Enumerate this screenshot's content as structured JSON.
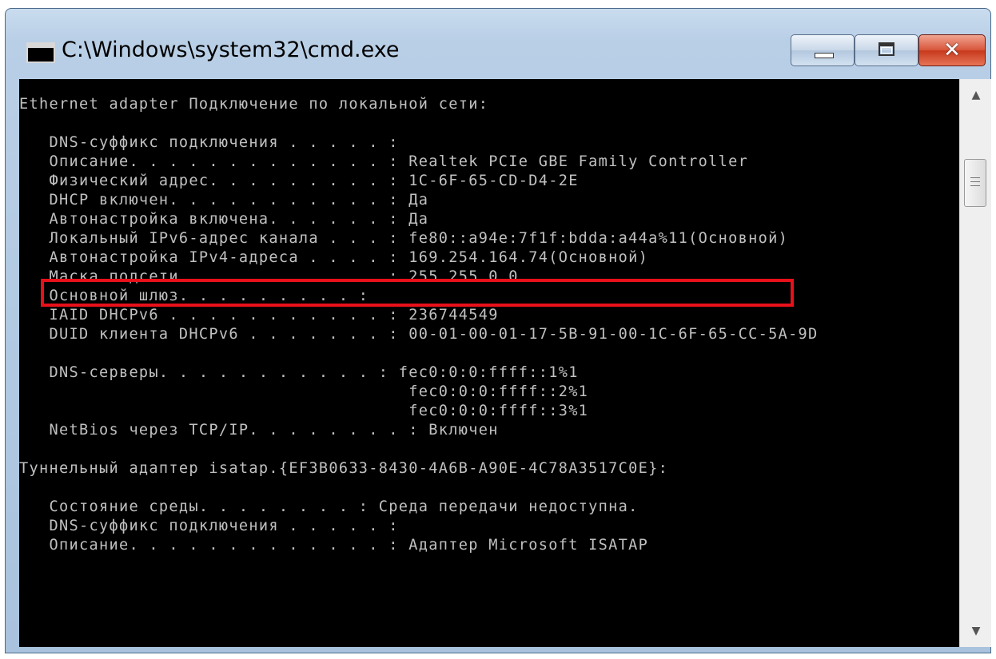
{
  "window": {
    "title": "C:\\Windows\\system32\\cmd.exe",
    "icon": "cmd-console-icon",
    "controls": {
      "minimize": "minimize-icon",
      "maximize": "maximize-icon",
      "close_glyph": "✕"
    },
    "colors": {
      "console_bg": "#000000",
      "console_text": "#c0c0c0",
      "highlight_border": "#e8101a",
      "close_button": "#c7381b"
    }
  },
  "console": {
    "lines": [
      "Ethernet adapter Подключение по локальной сети:",
      "",
      "   DNS-суффикс подключения . . . . . :",
      "   Описание. . . . . . . . . . . . . : Realtek PCIe GBE Family Controller",
      "   Физический адрес. . . . . . . . . : 1C-6F-65-CD-D4-2E",
      "   DHCP включен. . . . . . . . . . . : Да",
      "   Автонастройка включена. . . . . . : Да",
      "   Локальный IPv6-адрес канала . . . : fe80::a94e:7f1f:bdda:a44a%11(Основной)",
      "   Автонастройка IPv4-адреса . . . . : 169.254.164.74(Основной)",
      "   Маска подсети . . . . . . . . . . : 255.255.0.0",
      "   Основной шлюз. . . . . . . . . :",
      "   IAID DHCPv6 . . . . . . . . . . . : 236744549",
      "   DUID клиента DHCPv6 . . . . . . . : 00-01-00-01-17-5B-91-00-1C-6F-65-CC-5A-9D",
      "",
      "   DNS-серверы. . . . . . . . . . . : fec0:0:0:ffff::1%1",
      "                                       fec0:0:0:ffff::2%1",
      "                                       fec0:0:0:ffff::3%1",
      "   NetBios через TCP/IP. . . . . . . . : Включен",
      "",
      "Туннельный адаптер isatap.{EF3B0633-8430-4A6B-A90E-4C78A3517C0E}:",
      "",
      "   Состояние среды. . . . . . . . : Среда передачи недоступна.",
      "   DNS-суффикс подключения . . . . . :",
      "   Описание. . . . . . . . . . . . . : Адаптер Microsoft ISATAP"
    ]
  },
  "scrollbar": {
    "up_arrow": "▲",
    "down_arrow": "▼"
  }
}
